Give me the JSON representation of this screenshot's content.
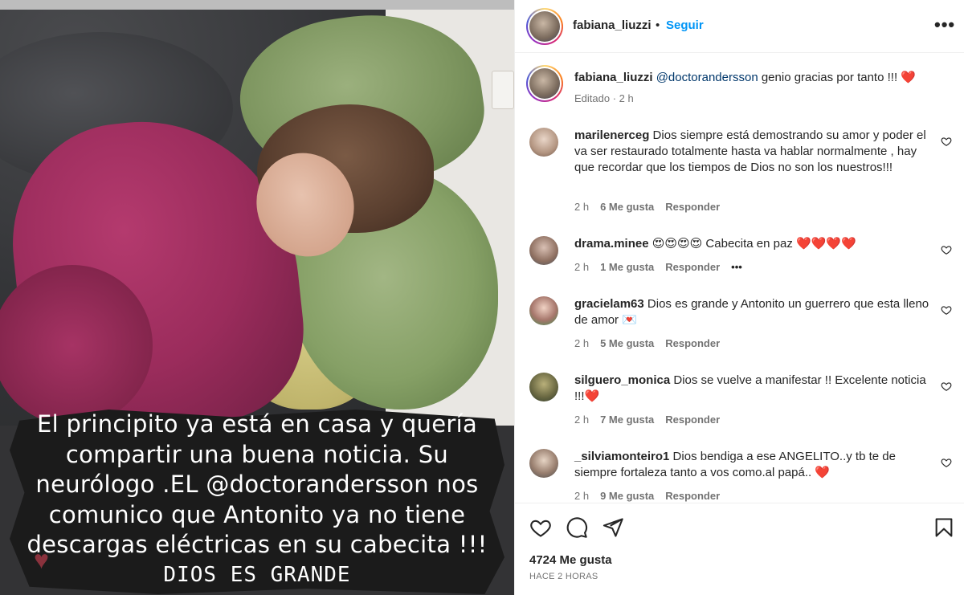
{
  "post": {
    "caption_lines": [
      "El principito ya  está en casa y quería",
      "compartir una buena noticia. Su",
      "neurólogo  .EL @doctorandersson nos",
      "comunico que Antonito  ya no tiene",
      "descargas eléctricas en su cabecita !!!",
      "DIOS ES GRANDE"
    ]
  },
  "header": {
    "username": "fabiana_liuzzi",
    "separator": "•",
    "follow_label": "Seguir",
    "more_label": "•••"
  },
  "caption": {
    "username": "fabiana_liuzzi",
    "mention": "@doctorandersson",
    "text": " genio gracias por tanto !!! ",
    "emoji": "❤️",
    "edited": "Editado",
    "dot": " · ",
    "time": "2 h"
  },
  "comments": [
    {
      "username": "marilenerceg",
      "text": " Dios siempre está demostrando su amor y poder el va ser restaurado totalmente hasta va hablar normalmente , hay que recordar que los tiempos de Dios no son los nuestros!!!",
      "time": "2 h",
      "likes": "6 Me gusta",
      "reply": "Responder"
    },
    {
      "username": "drama.minee",
      "text": " 😍😍😍😍 Cabecita en paz ",
      "hearts": "❤️❤️❤️❤️",
      "time": "2 h",
      "likes": "1 Me gusta",
      "reply": "Responder",
      "more": "•••"
    },
    {
      "username": "gracielam63",
      "text": " Dios es grande y Antonito un guerrero que esta lleno de amor ",
      "emoji": "💌",
      "time": "2 h",
      "likes": "5 Me gusta",
      "reply": "Responder"
    },
    {
      "username": "silguero_monica",
      "text": " Dios se vuelve a manifestar !! Excelente noticia !!!",
      "emoji": "❤️",
      "time": "2 h",
      "likes": "7 Me gusta",
      "reply": "Responder"
    },
    {
      "username": "_silviamonteiro1",
      "text": " Dios bendiga a ese ANGELITO..y tb te de siempre fortaleza tanto a vos como.al papá.. ",
      "emoji": "❤️",
      "time": "2 h",
      "likes": "9 Me gusta",
      "reply": "Responder"
    }
  ],
  "footer": {
    "likes": "4724 Me gusta",
    "ago": "HACE 2 HORAS"
  },
  "colors": {
    "accent": "#0095f6",
    "mention": "#00376b",
    "heart": "#ed4956",
    "muted": "#737373"
  },
  "icons": {
    "like": "heart-outline-icon",
    "comment": "comment-bubble-icon",
    "share": "paper-plane-icon",
    "save": "bookmark-icon",
    "more": "ellipsis-icon"
  }
}
